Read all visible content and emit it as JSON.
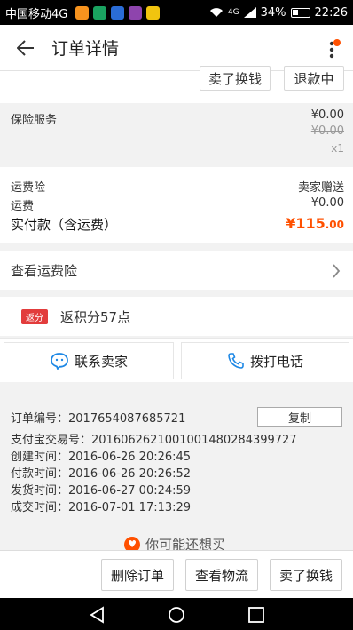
{
  "status_bar": {
    "carrier": "中国移动4G",
    "network": "4G",
    "battery": "34%",
    "time": "22:26"
  },
  "header": {
    "title": "订单详情"
  },
  "top_actions": {
    "sell_swap": "卖了换钱",
    "refunding": "退款中"
  },
  "insurance_item": {
    "name": "保险服务",
    "price": "¥0.00",
    "original_price": "¥0.00",
    "quantity": "x1"
  },
  "totals": {
    "freight_insurance_label": "运费险",
    "freight_insurance_value": "卖家赠送",
    "shipping_label": "运费",
    "shipping_value": "¥0.00",
    "paid_label": "实付款（含运费）",
    "paid_currency": "¥",
    "paid_int": "115",
    "paid_dec": ".00"
  },
  "freight_link": {
    "label": "查看运费险"
  },
  "points": {
    "badge": "返分",
    "text": "返积分57点"
  },
  "contact": {
    "seller": "联系卖家",
    "call": "拨打电话"
  },
  "order_info": {
    "order_no": "订单编号：2017654087685721",
    "copy": "复制",
    "alipay_no": "支付宝交易号：2016062621001001480284399727",
    "created": "创建时间：2016-06-26 20:26:45",
    "paid": "付款时间：2016-06-26 20:26:52",
    "shipped": "发货时间：2016-06-27 00:24:59",
    "closed": "成交时间：2016-07-01 17:13:29"
  },
  "recommend": {
    "label": "你可能还想买"
  },
  "bottom_bar": {
    "delete": "删除订单",
    "logistics": "查看物流",
    "sell_swap": "卖了换钱"
  },
  "colors": {
    "accent": "#ff5000",
    "badge_red": "#e23c3c"
  }
}
